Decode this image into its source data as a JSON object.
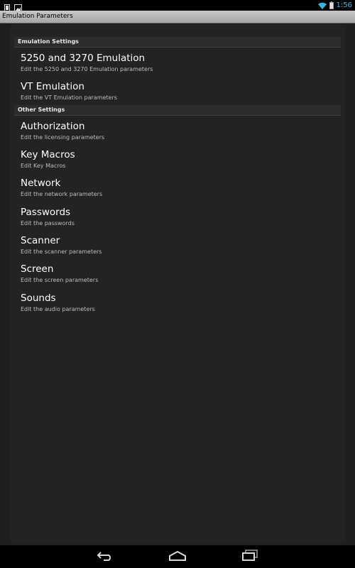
{
  "status_bar": {
    "time": "1:56",
    "left_icons": [
      "notification-phone-icon",
      "notification-image-icon"
    ],
    "right_icons": [
      "wifi-icon",
      "battery-icon"
    ],
    "accent_color": "#33b5e5"
  },
  "title_bar": {
    "title": "Emulation Parameters"
  },
  "sections": [
    {
      "header": "Emulation Settings",
      "items": [
        {
          "title": "5250 and 3270 Emulation",
          "summary": "Edit the 5250 and 3270 Emulation parameters"
        },
        {
          "title": "VT Emulation",
          "summary": "Edit the VT Emulation parameters"
        }
      ]
    },
    {
      "header": "Other Settings",
      "items": [
        {
          "title": "Authorization",
          "summary": "Edit the licensing parameters"
        },
        {
          "title": "Key Macros",
          "summary": "Edit Key Macros"
        },
        {
          "title": "Network",
          "summary": "Edit the network parameters"
        },
        {
          "title": "Passwords",
          "summary": "Edit the passwords"
        },
        {
          "title": "Scanner",
          "summary": "Edit the scanner parameters"
        },
        {
          "title": "Screen",
          "summary": "Edit the screen parameters"
        },
        {
          "title": "Sounds",
          "summary": "Edit the audio parameters"
        }
      ]
    }
  ],
  "nav_bar": {
    "buttons": [
      "back-icon",
      "home-icon",
      "recent-apps-icon"
    ]
  }
}
